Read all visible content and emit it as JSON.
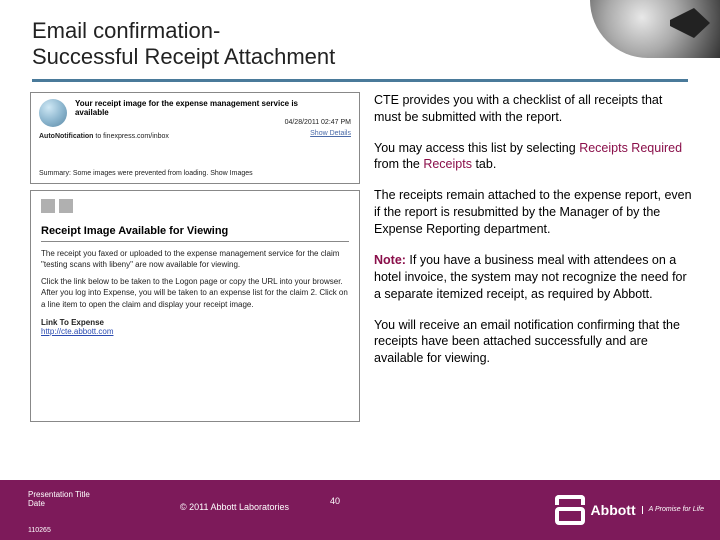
{
  "header": {
    "title_line1": "Email confirmation-",
    "title_line2": "Successful Receipt Attachment"
  },
  "email_preview": {
    "subject": "Your receipt image for the expense management service is available",
    "auto_label": "AutoNotification",
    "to": "to finexpress.com/inbox",
    "timestamp": "04/28/2011 02:47 PM",
    "show_details": "Show Details",
    "summary_label": "Summary:",
    "summary_text": "Some images were prevented from loading.   Show Images"
  },
  "email_body": {
    "heading": "Receipt Image Available for Viewing",
    "p1": "The receipt you faxed or uploaded to the expense management service for the claim \"testing scans with libeny\" are now available for viewing.",
    "p2": "Click the link below to be taken to the Logon page or copy the URL into your browser. After you log into Expense, you will be taken to an expense list for the claim 2. Click on a line item to open the claim and display your receipt image.",
    "link_label": "Link To Expense",
    "url": "http://cte.abbott.com"
  },
  "right": {
    "p1": "CTE provides you with a checklist of all receipts that must be submitted with the report.",
    "p2_a": "You may access this list by selecting ",
    "p2_hl1": "Receipts Required",
    "p2_b": " from the ",
    "p2_hl2": "Receipts",
    "p2_c": " tab.",
    "p3": "The receipts remain attached to the expense report, even if the report is resubmitted by the Manager of by the Expense Reporting department.",
    "note_label": "Note:",
    "p4": " If you have a business meal with attendees on a hotel invoice, the system may not recognize the need for a separate itemized receipt, as required by Abbott.",
    "p5": "You will receive an email notification confirming that the receipts have been attached successfully and are available for viewing."
  },
  "footer": {
    "presentation_title": "Presentation Title",
    "date": "Date",
    "copyright": "© 2011 Abbott Laboratories",
    "page": "40",
    "code": "110265",
    "logo_text": "Abbott",
    "logo_tagline": "A Promise for Life"
  }
}
